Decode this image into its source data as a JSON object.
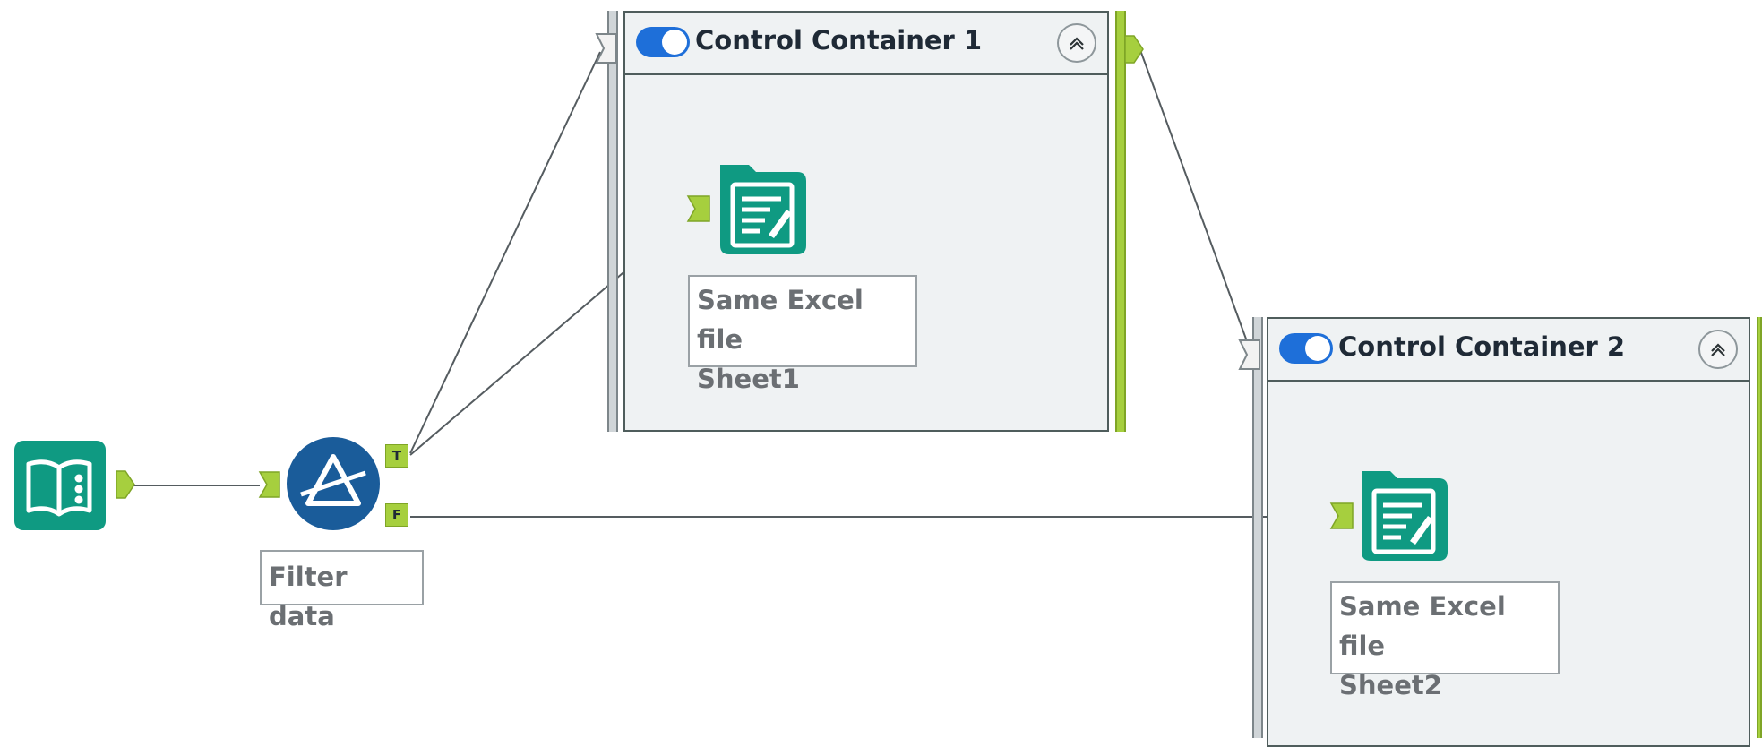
{
  "canvas": {
    "background": "#ffffff",
    "wire_color": "#555c60",
    "anchor_color": "#a6cf3e",
    "tool_teal": "#0f9a82",
    "filter_blue": "#1a5c9a"
  },
  "containers": [
    {
      "title": "Control Container 1",
      "enabled": true,
      "icons": [
        "toggle-icon",
        "collapse-icon"
      ]
    },
    {
      "title": "Control Container 2",
      "enabled": true,
      "icons": [
        "toggle-icon",
        "collapse-icon"
      ]
    }
  ],
  "tools": {
    "input": {
      "icon": "book-input-icon"
    },
    "filter": {
      "label": "Filter data",
      "icon": "prism-filter-icon",
      "true_anchor": "T",
      "false_anchor": "F"
    },
    "output1": {
      "label": "Same Excel file\nSheet1",
      "icon": "output-sheet-icon"
    },
    "output2": {
      "label": "Same Excel file\nSheet2",
      "icon": "output-sheet-icon"
    }
  }
}
